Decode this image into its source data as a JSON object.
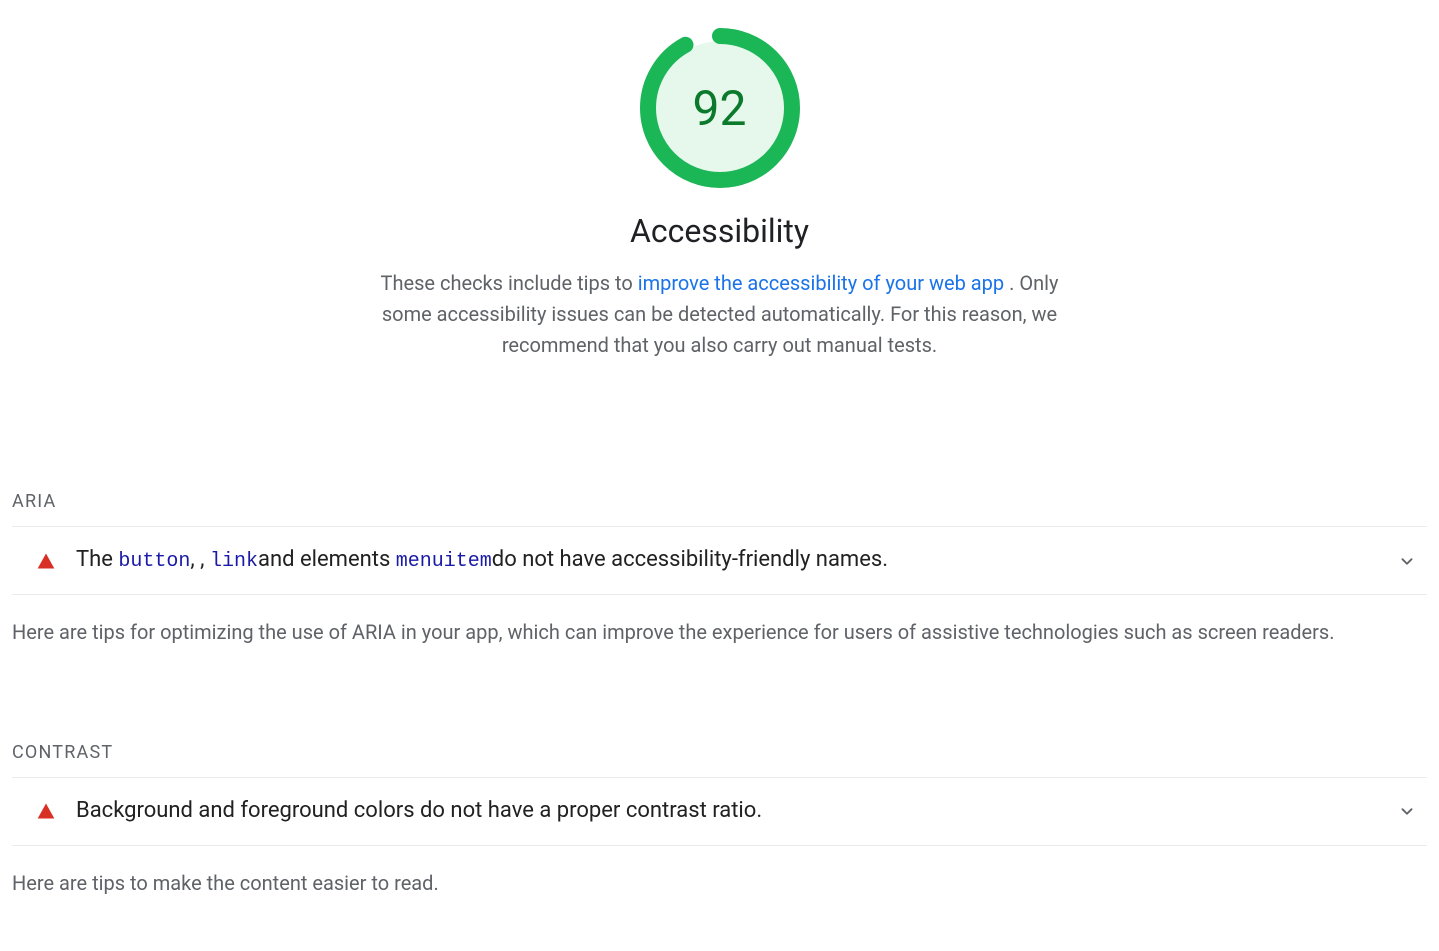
{
  "score": {
    "value": "92",
    "percent": 92,
    "category": "Accessibility",
    "desc_prefix": "These checks include tips to ",
    "desc_link": "improve the accessibility of your web app",
    "desc_suffix": " . Only some accessibility issues can be detected automatically. For this reason, we recommend that you also carry out manual tests."
  },
  "sections": {
    "aria": {
      "heading": "ARIA",
      "audit": {
        "t0": "The ",
        "code1": "button",
        "t1": ", , ",
        "code2": "link",
        "t2": "and elements ",
        "code3": "menuitem",
        "t3": "do not have accessibility-friendly names."
      },
      "note": "Here are tips for optimizing the use of ARIA in your app, which can improve the experience for users of assistive technologies such as screen readers."
    },
    "contrast": {
      "heading": "CONTRAST",
      "audit_title": "Background and foreground colors do not have a proper contrast ratio.",
      "note": "Here are tips to make the content easier to read."
    }
  }
}
